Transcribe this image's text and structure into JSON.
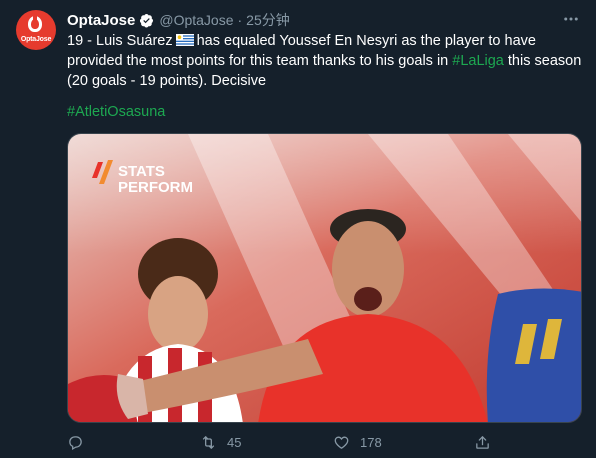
{
  "tweet": {
    "avatar_text": "OptaJose",
    "display_name": "OptaJose",
    "handle": "@OptaJose",
    "separator": "·",
    "time": "25分钟",
    "text_part1": "19 - Luis Suárez",
    "text_part2": "has equaled Youssef En Nesyri as the player to have provided the most points for this team thanks to his goals in",
    "hashtag_inline": "#LaLiga",
    "text_part3": "this season (20 goals - 19 points). Decisive",
    "hashtag": "#AtletiOsasuna",
    "media": {
      "watermark_line1": "STATS",
      "watermark_line2": "PERFORM"
    },
    "stats": {
      "retweets": "45",
      "likes": "178"
    }
  },
  "icons": {
    "verified": "verified-badge-icon",
    "more": "more-options-icon",
    "flag": "uruguay-flag-icon",
    "reply": "reply-icon",
    "retweet": "retweet-icon",
    "like": "heart-icon",
    "share": "share-icon"
  },
  "colors": {
    "background": "#15202b",
    "text": "#ffffff",
    "secondary": "#8899a6",
    "hashtag": "#1da851",
    "verified": "#ffffff",
    "avatar": "#e63b2e"
  }
}
